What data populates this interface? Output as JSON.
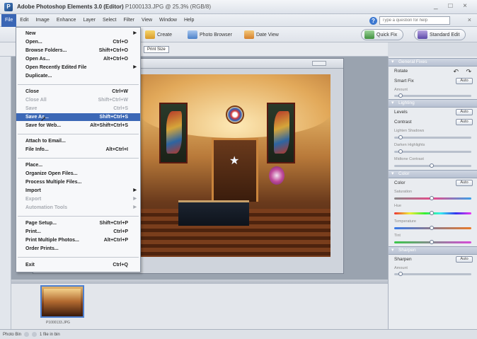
{
  "window": {
    "app_name": "Adobe Photoshop Elements 3.0 (Editor)",
    "doc_info": "P1000133.JPG @ 25.3% (RGB/8)",
    "controls": "_ □ ×"
  },
  "menubar": {
    "items": [
      "File",
      "Edit",
      "Image",
      "Enhance",
      "Layer",
      "Select",
      "Filter",
      "View",
      "Window",
      "Help"
    ],
    "help_placeholder": "Type a question for help",
    "close": "×"
  },
  "toolbar": {
    "create": "Create",
    "photo_browser": "Photo Browser",
    "date_view": "Date View",
    "quick_fix": "Quick Fix",
    "standard_edit": "Standard Edit"
  },
  "options": {
    "print_size": "Print Size"
  },
  "file_menu": {
    "items": [
      {
        "label": "New",
        "shortcut": "",
        "submenu": true,
        "disabled": false
      },
      {
        "label": "Open...",
        "shortcut": "Ctrl+O",
        "submenu": false,
        "disabled": false
      },
      {
        "label": "Browse Folders...",
        "shortcut": "Shift+Ctrl+O",
        "submenu": false,
        "disabled": false
      },
      {
        "label": "Open As...",
        "shortcut": "Alt+Ctrl+O",
        "submenu": false,
        "disabled": false
      },
      {
        "label": "Open Recently Edited File",
        "shortcut": "",
        "submenu": true,
        "disabled": false
      },
      {
        "label": "Duplicate...",
        "shortcut": "",
        "submenu": false,
        "disabled": false
      },
      {
        "label": "Close",
        "shortcut": "Ctrl+W",
        "submenu": false,
        "disabled": false
      },
      {
        "label": "Close All",
        "shortcut": "Shift+Ctrl+W",
        "submenu": false,
        "disabled": true
      },
      {
        "label": "Save",
        "shortcut": "Ctrl+S",
        "submenu": false,
        "disabled": true
      },
      {
        "label": "Save As...",
        "shortcut": "Shift+Ctrl+S",
        "submenu": false,
        "disabled": false,
        "highlighted": true
      },
      {
        "label": "Save for Web...",
        "shortcut": "Alt+Shift+Ctrl+S",
        "submenu": false,
        "disabled": false
      },
      {
        "label": "Attach to Email...",
        "shortcut": "",
        "submenu": false,
        "disabled": false
      },
      {
        "label": "File Info...",
        "shortcut": "Alt+Ctrl+I",
        "submenu": false,
        "disabled": false
      },
      {
        "label": "Place...",
        "shortcut": "",
        "submenu": false,
        "disabled": false
      },
      {
        "label": "Organize Open Files...",
        "shortcut": "",
        "submenu": false,
        "disabled": false
      },
      {
        "label": "Process Multiple Files...",
        "shortcut": "",
        "submenu": false,
        "disabled": false
      },
      {
        "label": "Import",
        "shortcut": "",
        "submenu": true,
        "disabled": false
      },
      {
        "label": "Export",
        "shortcut": "",
        "submenu": true,
        "disabled": true
      },
      {
        "label": "Automation Tools",
        "shortcut": "",
        "submenu": true,
        "disabled": true
      },
      {
        "label": "Page Setup...",
        "shortcut": "Shift+Ctrl+P",
        "submenu": false,
        "disabled": false
      },
      {
        "label": "Print...",
        "shortcut": "Ctrl+P",
        "submenu": false,
        "disabled": false
      },
      {
        "label": "Print Multiple Photos...",
        "shortcut": "Alt+Ctrl+P",
        "submenu": false,
        "disabled": false
      },
      {
        "label": "Order Prints...",
        "shortcut": "",
        "submenu": false,
        "disabled": false
      },
      {
        "label": "Exit",
        "shortcut": "Ctrl+Q",
        "submenu": false,
        "disabled": false
      }
    ]
  },
  "palette": {
    "general_fixes": "General Fixes",
    "rotate": "Rotate",
    "smart_fix": "Smart Fix",
    "amount": "Amount",
    "auto": "Auto",
    "lighting": "Lighting",
    "levels": "Levels",
    "contrast": "Contrast",
    "lighten_shadows": "Lighten Shadows",
    "darken_highlights": "Darken Highlights",
    "midtone_contrast": "Midtone Contrast",
    "color": "Color",
    "color_label": "Color",
    "saturation": "Saturation",
    "hue": "Hue",
    "temperature": "Temperature",
    "tint": "Tint",
    "sharpen": "Sharpen",
    "sharpen_label": "Sharpen",
    "sharpen_amount": "Amount"
  },
  "photobin": {
    "thumb_label": "P1000133.JPG"
  },
  "statusbar": {
    "photo_bin": "Photo Bin",
    "file_info": "1 file in bin"
  },
  "colors": {
    "menu_highlight": "#3c68b6",
    "accent": "#3a66b5"
  }
}
